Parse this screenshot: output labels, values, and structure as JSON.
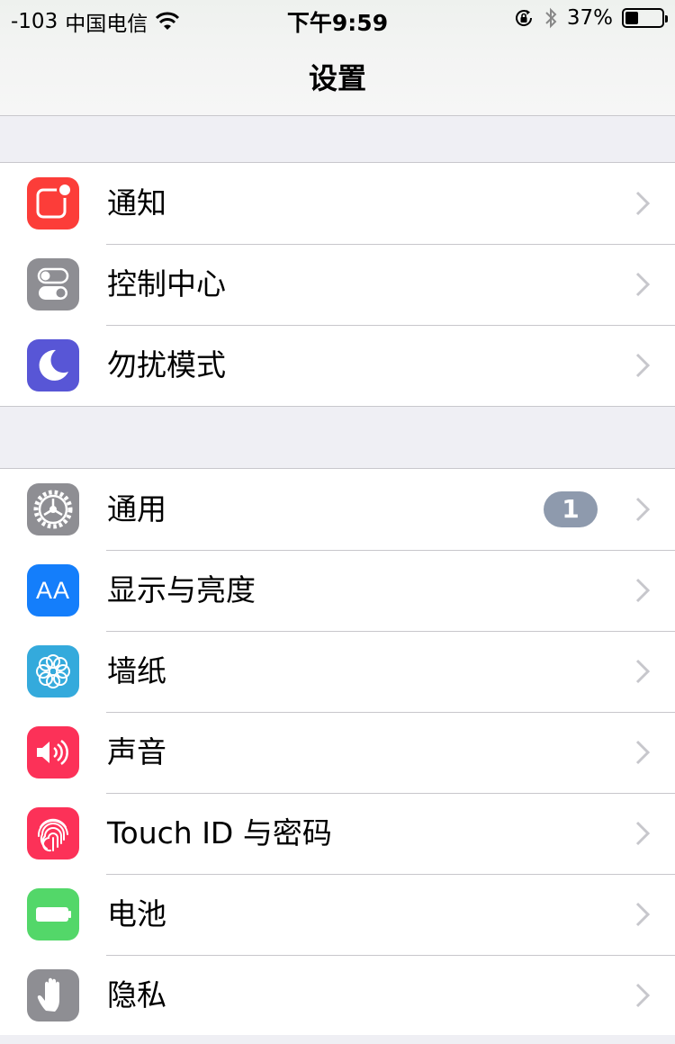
{
  "status_bar": {
    "signal": "-103",
    "carrier": "中国电信",
    "time": "下午9:59",
    "battery_percent": "37%",
    "battery_level": 0.37
  },
  "nav": {
    "title": "设置"
  },
  "groups": [
    {
      "items": [
        {
          "label": "通知",
          "icon": "notifications-icon",
          "color": "#fc3d39"
        },
        {
          "label": "控制中心",
          "icon": "control-center-icon",
          "color": "#8e8e93"
        },
        {
          "label": "勿扰模式",
          "icon": "do-not-disturb-icon",
          "color": "#5856d6"
        }
      ]
    },
    {
      "items": [
        {
          "label": "通用",
          "icon": "gear-icon",
          "color": "#8e8e93",
          "badge": "1"
        },
        {
          "label": "显示与亮度",
          "icon": "display-brightness-icon",
          "color": "#147efb",
          "icon_text": "AA"
        },
        {
          "label": "墙纸",
          "icon": "wallpaper-icon",
          "color": "#34aadc"
        },
        {
          "label": "声音",
          "icon": "speaker-icon",
          "color": "#fc3158"
        },
        {
          "label": "Touch ID 与密码",
          "icon": "fingerprint-icon",
          "color": "#fc3158"
        },
        {
          "label": "电池",
          "icon": "battery-icon",
          "color": "#53d769"
        },
        {
          "label": "隐私",
          "icon": "hand-icon",
          "color": "#8e8e93"
        }
      ]
    }
  ]
}
